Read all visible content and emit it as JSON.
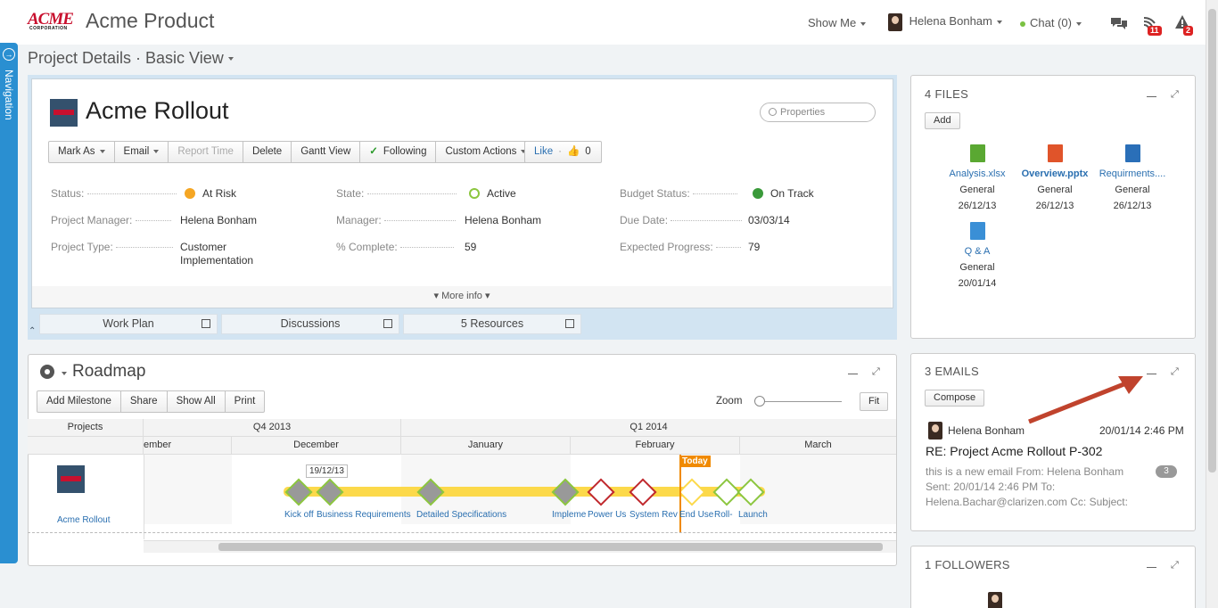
{
  "header": {
    "logo_text": "ACME",
    "logo_sub": "CORPORATION",
    "app_title": "Acme Product",
    "show_me": "Show Me",
    "user_name": "Helena Bonham",
    "chat": "Chat (0)",
    "notifications_count": "11",
    "alerts_count": "2"
  },
  "nav": {
    "label": "Navigation"
  },
  "breadcrumb": {
    "title": "Project Details · Basic View"
  },
  "project": {
    "title": "Acme Rollout",
    "search_placeholder": "Properties",
    "actions": [
      "Mark As",
      "Email",
      "Report Time",
      "Delete",
      "Gantt View",
      "Following",
      "Custom Actions"
    ],
    "like_label": "Like",
    "like_count": "0",
    "fields": {
      "status_label": "Status:",
      "status_value": "At Risk",
      "pm_label": "Project Manager:",
      "pm_value": "Helena Bonham",
      "type_label": "Project Type:",
      "type_value_1": "Customer",
      "type_value_2": "Implementation",
      "state_label": "State:",
      "state_value": "Active",
      "manager_label": "Manager:",
      "manager_value": "Helena Bonham",
      "complete_label": "% Complete:",
      "complete_value": "59",
      "budget_label": "Budget Status:",
      "budget_value": "On Track",
      "due_label": "Due Date:",
      "due_value": "03/03/14",
      "expected_label": "Expected Progress:",
      "expected_value": "79"
    },
    "more_info": "More info",
    "tabs": [
      "Work Plan",
      "Discussions",
      "5 Resources"
    ]
  },
  "roadmap": {
    "title": "Roadmap",
    "buttons": [
      "Add Milestone",
      "Share",
      "Show All",
      "Print"
    ],
    "zoom_label": "Zoom",
    "fit_label": "Fit",
    "col_projects": "Projects",
    "quarters": [
      "Q4 2013",
      "Q1 2014"
    ],
    "months": [
      "ember",
      "December",
      "January",
      "February",
      "March"
    ],
    "project_name": "Acme Rollout",
    "date_tip": "19/12/13",
    "today": "Today",
    "milestones": [
      "Kick off",
      "Business Requirements",
      "Detailed Specifications",
      "Impleme",
      "Power Us",
      "System Rev",
      "End Use",
      "Roll-",
      "Launch"
    ]
  },
  "files": {
    "title": "4 FILES",
    "add_label": "Add",
    "items": [
      {
        "name": "Analysis.xlsx",
        "folder": "General",
        "date": "26/12/13",
        "color": "#5aa832"
      },
      {
        "name": "Overview.pptx",
        "folder": "General",
        "date": "26/12/13",
        "color": "#e0542a"
      },
      {
        "name": "Requirments....",
        "folder": "General",
        "date": "26/12/13",
        "color": "#2a6fb8"
      },
      {
        "name": "Q & A",
        "folder": "General",
        "date": "20/01/14",
        "color": "#3a8fd6"
      }
    ]
  },
  "emails": {
    "title": "3 EMAILS",
    "compose_label": "Compose",
    "sender": "Helena Bonham",
    "date": "20/01/14 2:46 PM",
    "subject": "RE: Project Acme Rollout P-302",
    "preview_1": "this is a new email From: Helena Bonham",
    "preview_2": "Sent: 20/01/14 2:46 PM To:",
    "preview_3": "Helena.Bachar@clarizen.com Cc: Subject:",
    "count": "3"
  },
  "followers": {
    "title": "1 FOLLOWERS"
  }
}
